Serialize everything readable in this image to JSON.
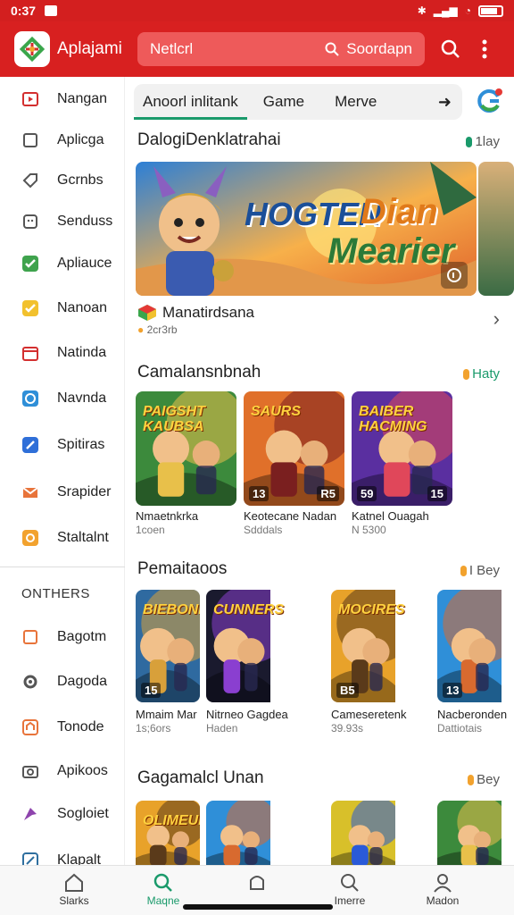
{
  "status": {
    "time": "0:37"
  },
  "appbar": {
    "name": "Aplajami",
    "search_left": "Netlcrl",
    "search_right": "Soordapn"
  },
  "sidebar": {
    "items": [
      {
        "label": "Nangan",
        "icon": "play-icon",
        "color": "#d32f2f"
      },
      {
        "label": "Aplicga",
        "icon": "square-icon",
        "color": "#555555"
      },
      {
        "label": "Gcrnbs",
        "icon": "tag-icon",
        "color": "#555555"
      },
      {
        "label": "Senduss",
        "icon": "face-icon",
        "color": "#555555"
      },
      {
        "label": "Apliauce",
        "icon": "check-icon",
        "color": "#3fa34d"
      },
      {
        "label": "Nanoan",
        "icon": "check-icon",
        "color": "#f2c12e"
      },
      {
        "label": "Natinda",
        "icon": "calendar-icon",
        "color": "#d32f2f"
      },
      {
        "label": "Navnda",
        "icon": "circle-icon",
        "color": "#2f8fd8"
      },
      {
        "label": "Spitiras",
        "icon": "link-icon",
        "color": "#2f6fd8"
      },
      {
        "label": "Srapider",
        "icon": "mail-icon",
        "color": "#e8743b"
      },
      {
        "label": "Staltalnt",
        "icon": "star-icon",
        "color": "#f2a22e"
      }
    ],
    "section": "ONTHERS",
    "others": [
      {
        "label": "Bagotm",
        "icon": "square-icon",
        "color": "#e8743b"
      },
      {
        "label": "Dagoda",
        "icon": "gear-icon",
        "color": "#555555"
      },
      {
        "label": "Tonode",
        "icon": "home-icon",
        "color": "#e8743b"
      },
      {
        "label": "Apikoos",
        "icon": "camera-icon",
        "color": "#555555"
      },
      {
        "label": "Sogloiet",
        "icon": "arrow-icon",
        "color": "#8e44ad"
      },
      {
        "label": "Klapalt",
        "icon": "edit-icon",
        "color": "#2f6f9f"
      }
    ]
  },
  "tabs": [
    "Anoorl inlitank",
    "Game",
    "Merve"
  ],
  "sections": {
    "s1": {
      "title": "DalogiDenklatrahai",
      "more": "1lay"
    },
    "s2": {
      "title": "Camalansnbnah",
      "more": "Haty"
    },
    "s3": {
      "title": "Pemaitaoos",
      "more": "I Bey"
    },
    "s4": {
      "title": "Gagamalcl Unan",
      "more": "Bey"
    }
  },
  "banner": {
    "line1": "HOGTEN",
    "line2": "Dian",
    "line3": "Mearier"
  },
  "featured": {
    "name": "Manatirdsana",
    "sub": "2cr3rb"
  },
  "row1": [
    {
      "title": "PAIGSHT KAUBSA",
      "badge": "",
      "badge_r": "",
      "name": "Nmaetnkrka",
      "sub": "1coen"
    },
    {
      "title": "SAURS",
      "badge": "13",
      "badge_r": "R5",
      "name": "Keotecane Nadan",
      "sub": "Sdddals"
    },
    {
      "title": "BAIBER HACMING",
      "badge": "59",
      "badge_r": "15",
      "name": "Katnel Ouagah",
      "sub": "N 5300"
    }
  ],
  "row2": [
    {
      "title": "BIEBONH",
      "badge": "15",
      "name": "Mmaim Mar",
      "sub": "1s;6ors"
    },
    {
      "title": "CUNNERS",
      "badge": "",
      "name": "Nitrneo Gagdea",
      "sub": "Haden"
    },
    {
      "title": "MOCIRES",
      "badge": "B5",
      "name": "Cameseretenk",
      "sub": "39.93s"
    },
    {
      "title": "",
      "badge": "13",
      "name": "Nacberonden",
      "sub": "Dattiotais"
    }
  ],
  "row3": [
    {
      "title": "OLIMEUBS"
    },
    {
      "title": ""
    },
    {
      "title": ""
    },
    {
      "title": ""
    }
  ],
  "nav": [
    "Slarks",
    "Maqne",
    "",
    "Imerre",
    "Madon"
  ]
}
